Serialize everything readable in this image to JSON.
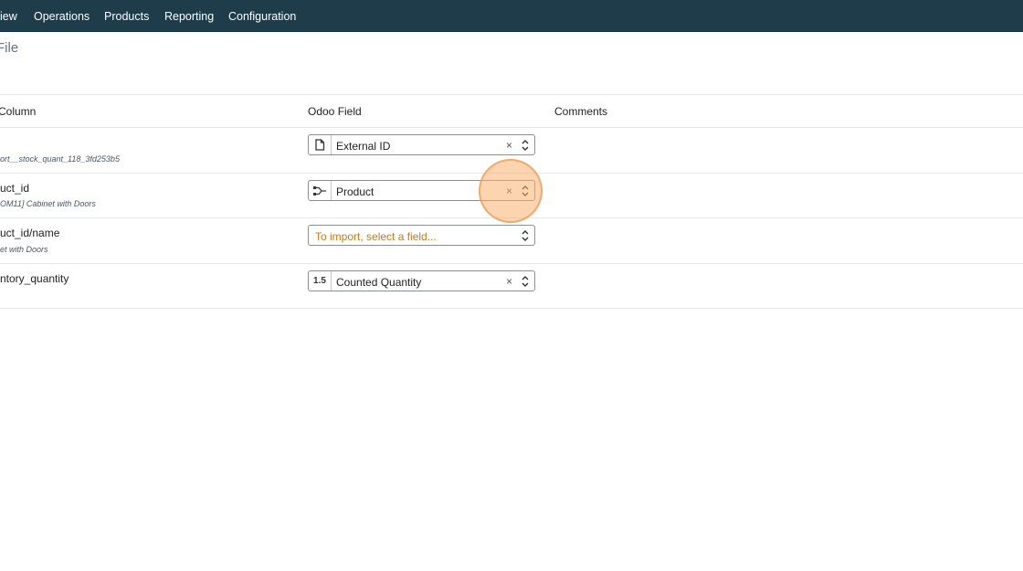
{
  "navbar": {
    "items": [
      "iew",
      "Operations",
      "Products",
      "Reporting",
      "Configuration"
    ]
  },
  "page": {
    "title": "File"
  },
  "table": {
    "headers": {
      "column": "Column",
      "field": "Odoo Field",
      "comments": "Comments"
    },
    "rows": [
      {
        "name": "",
        "sample": "ort__stock_quant_118_3fd253b5",
        "field_icon": "file-icon",
        "field": "External ID"
      },
      {
        "name": "uct_id",
        "sample": "OM11] Cabinet with Doors",
        "field_icon": "relation-icon",
        "field": "Product"
      },
      {
        "name": "uct_id/name",
        "sample": "et with Doors",
        "field_icon": "",
        "field": "To import, select a field..."
      },
      {
        "name": "ntory_quantity",
        "sample": "",
        "field_icon": "float-icon",
        "field": "Counted Quantity",
        "icon_text": "1.5"
      }
    ]
  },
  "icons": {
    "clear": "×"
  }
}
